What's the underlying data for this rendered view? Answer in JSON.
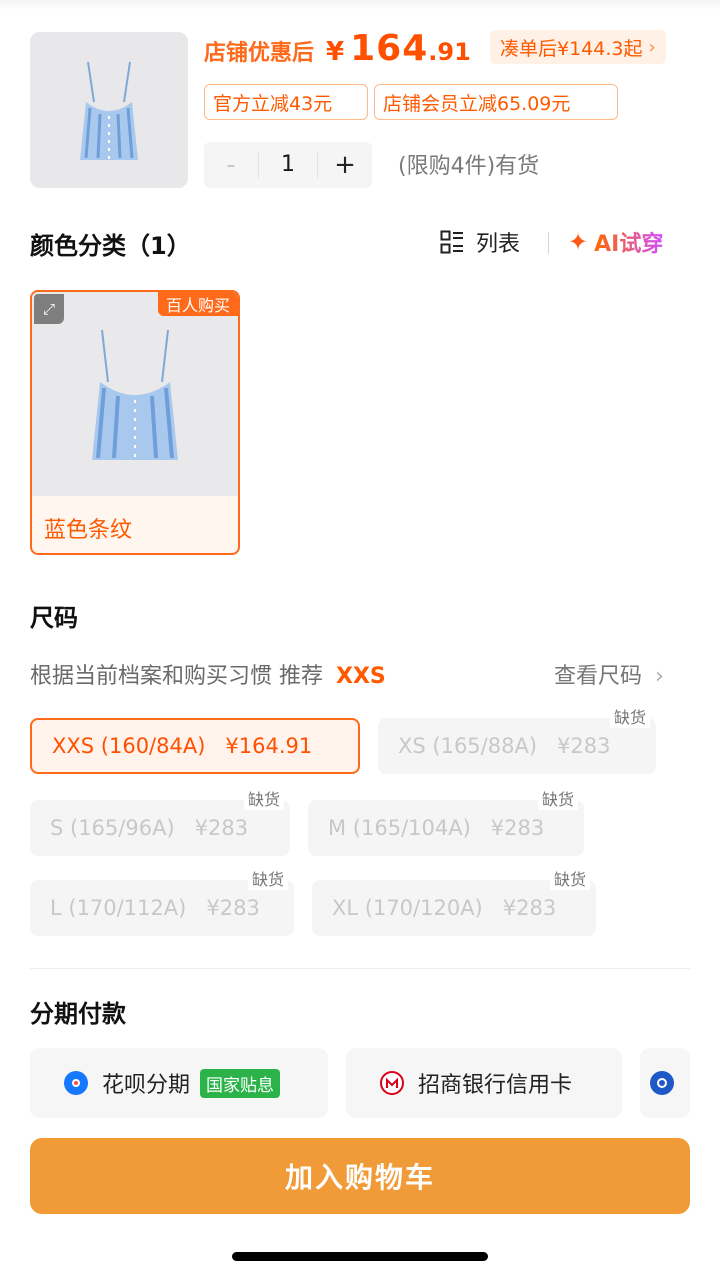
{
  "header": {
    "price_label": "店铺优惠后",
    "currency": "¥",
    "price_int": "164",
    "price_dec": ".91",
    "bundle_text": "凑单后¥144.3起",
    "bundle_chevron": "›",
    "coupons": [
      "官方立减43元",
      "店铺会员立减65.09元"
    ],
    "quantity": "1",
    "minus": "-",
    "plus": "+",
    "stock_text": "(限购4件)有货"
  },
  "color_section": {
    "title": "颜色分类（1）",
    "view_list_label": "列表",
    "ai_star": "✦",
    "ai_label": "AI试穿",
    "card": {
      "badge": "百人购买",
      "label": "蓝色条纹",
      "expand_icon": "⤢"
    }
  },
  "size_section": {
    "title": "尺码",
    "recommend_text": "根据当前档案和购买习惯 推荐",
    "recommend_size": "XXS",
    "size_chart_label": "查看尺码",
    "size_chart_chevron": "›",
    "sizes": [
      {
        "label": "XXS (160/84A)",
        "price": "¥164.91",
        "tag": ""
      },
      {
        "label": "XS (165/88A)",
        "price": "¥283",
        "tag": "缺货"
      },
      {
        "label": "S (165/96A)",
        "price": "¥283",
        "tag": "缺货"
      },
      {
        "label": "M (165/104A)",
        "price": "¥283",
        "tag": "缺货"
      },
      {
        "label": "L (170/112A)",
        "price": "¥283",
        "tag": "缺货"
      },
      {
        "label": "XL (170/120A)",
        "price": "¥283",
        "tag": "缺货"
      }
    ]
  },
  "installments": {
    "title": "分期付款",
    "options": [
      {
        "label": "花呗分期",
        "badge": "国家贴息"
      },
      {
        "label": "招商银行信用卡"
      }
    ]
  },
  "cart_button": "加入购物车",
  "colors": {
    "accent": "#ff5000",
    "cart": "#f09a38",
    "selected_bg": "#fff3ec",
    "badge_green": "#2bb34a"
  }
}
